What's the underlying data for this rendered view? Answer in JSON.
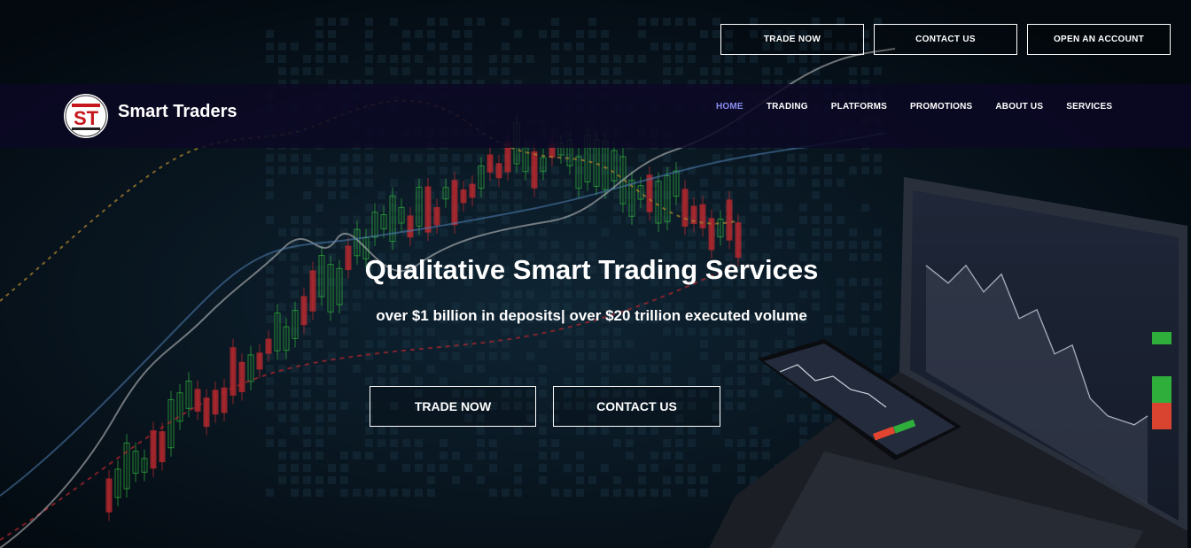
{
  "top_actions": {
    "trade_now": "TRADE NOW",
    "contact_us": "CONTACT US",
    "open_account": "OPEN AN ACCOUNT"
  },
  "brand": {
    "name": "Smart Traders",
    "logo_letters": "ST"
  },
  "nav": {
    "items": [
      {
        "label": "HOME",
        "active": true
      },
      {
        "label": "TRADING",
        "active": false
      },
      {
        "label": "PLATFORMS",
        "active": false
      },
      {
        "label": "PROMOTIONS",
        "active": false
      },
      {
        "label": "ABOUT US",
        "active": false
      },
      {
        "label": "SERVICES",
        "active": false
      }
    ]
  },
  "hero": {
    "title": "Qualitative Smart Trading Services",
    "subtitle": "over $1 billion in deposits| over $20 trillion executed volume",
    "trade_button": "TRADE NOW",
    "contact_button": "CONTACT US"
  },
  "colors": {
    "background": "#05101a",
    "navbar": "#0c0824",
    "nav_active": "#8a8cf0",
    "candle_up": "#2fae3c",
    "candle_down": "#c42a2f",
    "logo_red": "#c4161c"
  },
  "icons": {
    "logo": "st-logo",
    "devices": "laptop-and-phone-trading-app"
  }
}
